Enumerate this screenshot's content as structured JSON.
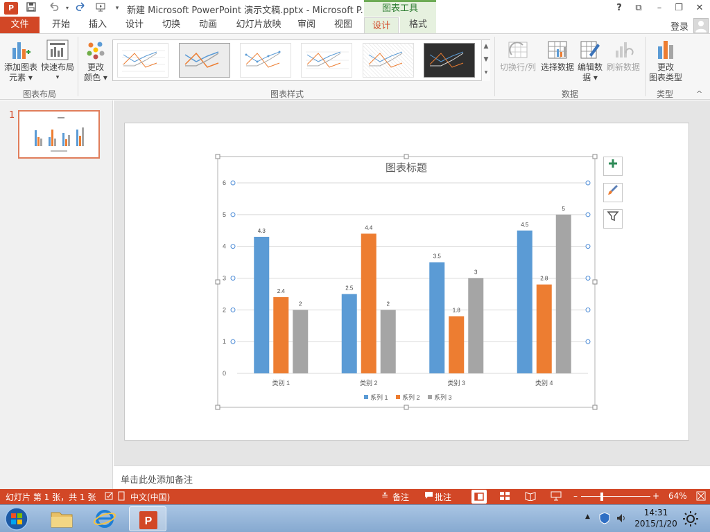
{
  "window": {
    "title": "新建 Microsoft PowerPoint 演示文稿.pptx - Microsoft P...",
    "context_tab": "图表工具",
    "help": "?",
    "controls": {
      "restore_ribbon": "⧉",
      "minimize": "–",
      "maximize": "❐",
      "close": "✕"
    }
  },
  "tabs": {
    "file": "文件",
    "items": [
      "开始",
      "插入",
      "设计",
      "切换",
      "动画",
      "幻灯片放映",
      "审阅",
      "视图",
      "设计",
      "格式"
    ],
    "active_index": 8,
    "login": "登录"
  },
  "ribbon": {
    "add_element": [
      "添加图表",
      "元素 ▾"
    ],
    "quick_layout": [
      "快速布局",
      "▾"
    ],
    "change_colors": [
      "更改",
      "颜色 ▾"
    ],
    "group_chart_layout": "图表布局",
    "group_chart_styles": "图表样式",
    "switch_row_col": "切换行/列",
    "select_data": "选择数据",
    "edit_data": [
      "编辑数",
      "据 ▾"
    ],
    "refresh_data": "刷新数据",
    "group_data": "数据",
    "change_type": [
      "更改",
      "图表类型"
    ],
    "group_type": "类型",
    "collapse_icon": "^"
  },
  "slides_pane": {
    "slide_number": "1"
  },
  "chart": {
    "title": "图表标题"
  },
  "chart_data": {
    "type": "bar",
    "title": "图表标题",
    "categories": [
      "类别 1",
      "类别 2",
      "类别 3",
      "类别 4"
    ],
    "series": [
      {
        "name": "系列 1",
        "values": [
          4.3,
          2.5,
          3.5,
          4.5
        ],
        "color": "#5b9bd5"
      },
      {
        "name": "系列 2",
        "values": [
          2.4,
          4.4,
          1.8,
          2.8
        ],
        "color": "#ed7d31"
      },
      {
        "name": "系列 3",
        "values": [
          2,
          2,
          3,
          5
        ],
        "color": "#a5a5a5"
      }
    ],
    "ylim": [
      0,
      6
    ],
    "yticks": [
      "0",
      "1",
      "2",
      "3",
      "4",
      "5",
      "6"
    ],
    "grid": true,
    "legend": "bottom"
  },
  "notes": {
    "placeholder": "单击此处添加备注"
  },
  "status": {
    "slide_info": "幻灯片 第 1 张，共 1 张",
    "language": "中文(中国)",
    "notes": "备注",
    "comments": "批注",
    "zoom": "64%"
  },
  "taskbar": {
    "time": "14:31",
    "date": "2015/1/20"
  },
  "colors": {
    "accent": "#d24726",
    "chart_tools": "#6dab55"
  }
}
